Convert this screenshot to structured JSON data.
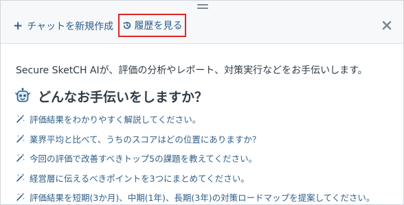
{
  "header": {
    "new_chat_label": "チャットを新規作成",
    "history_label": "履歴を見る",
    "close_symbol": "×",
    "plus_symbol": "+"
  },
  "main": {
    "intro": "Secure SketCH AIが、評価の分析やレポート、対策実行などをお手伝いします。",
    "heading": "どんなお手伝いをしますか？",
    "suggestions": [
      "評価結果をわかりやすく解説してください。",
      "業界平均と比べて、うちのスコアはどの位置にありますか？",
      "今回の評価で改善すべきトップ5の課題を教えてください。",
      "経営層に伝えるべきポイントを3つにまとめてください。",
      "評価結果を短期(3か月)、中期(1年)、長期(3年)の対策ロードマップを提案してください。"
    ]
  },
  "colors": {
    "accent": "#2f5e88",
    "highlight_border": "#e02424",
    "header_bg": "#f6f8fa"
  },
  "icons": {
    "history": "history-icon",
    "close": "close-icon",
    "robot": "robot-icon",
    "suggestion": "magic-wand-icon"
  }
}
